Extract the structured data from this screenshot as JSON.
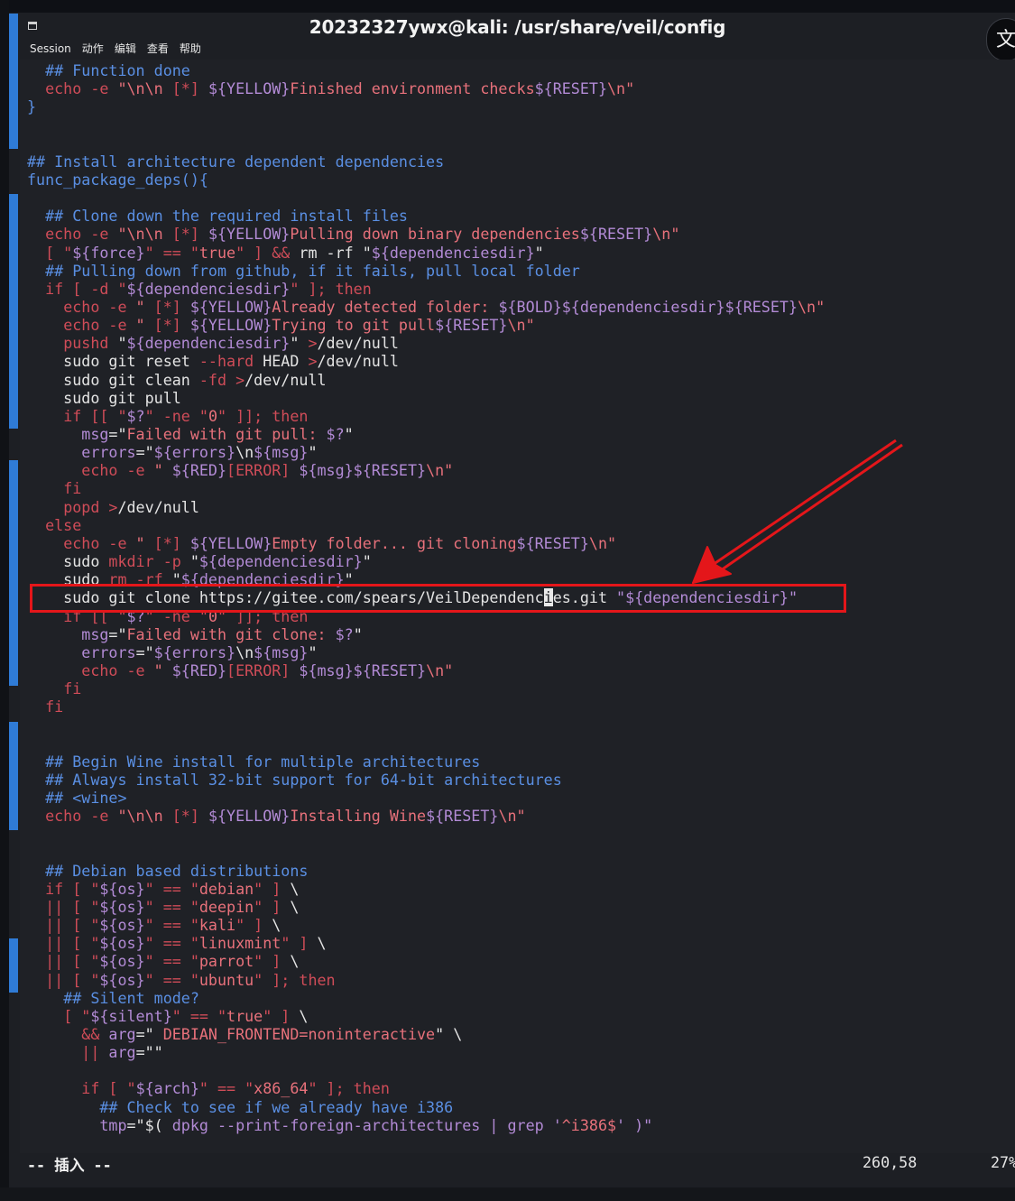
{
  "window": {
    "title": "20232327ywx@kali: /usr/share/veil/config",
    "translate_icon": "文"
  },
  "menubar": {
    "items": [
      "Session",
      "动作",
      "编辑",
      "查看",
      "帮助"
    ]
  },
  "colors": {
    "comment": "#5a8fe3",
    "keyword": "#cf4c58",
    "string": "#e8717b",
    "variable": "#b38bd6",
    "plain": "#e4e4e4",
    "annotation_red": "#e4161a"
  },
  "editor": {
    "lines": [
      [
        [
          "  ",
          "p"
        ],
        [
          "## Function done",
          "c"
        ]
      ],
      [
        [
          "  ",
          "p"
        ],
        [
          "echo",
          "k"
        ],
        [
          " ",
          "p"
        ],
        [
          "-e",
          "k"
        ],
        [
          " \"\\n\\n ",
          "s"
        ],
        [
          "[*]",
          "k"
        ],
        [
          " ",
          "s"
        ],
        [
          "${YELLOW}",
          "v"
        ],
        [
          "Finished environment checks",
          "s"
        ],
        [
          "${RESET}",
          "v"
        ],
        [
          "\\n\"",
          "s"
        ]
      ],
      [
        [
          "}",
          "c"
        ]
      ],
      [
        [
          "",
          "p"
        ]
      ],
      [
        [
          "",
          "p"
        ]
      ],
      [
        [
          "## Install architecture dependent dependencies",
          "c"
        ]
      ],
      [
        [
          "func_package_deps(){",
          "c"
        ]
      ],
      [
        [
          "",
          "p"
        ]
      ],
      [
        [
          "  ",
          "p"
        ],
        [
          "## Clone down the required install files",
          "c"
        ]
      ],
      [
        [
          "  ",
          "p"
        ],
        [
          "echo",
          "k"
        ],
        [
          " ",
          "p"
        ],
        [
          "-e",
          "k"
        ],
        [
          " \"\\n\\n ",
          "s"
        ],
        [
          "[*]",
          "k"
        ],
        [
          " ",
          "s"
        ],
        [
          "${YELLOW}",
          "v"
        ],
        [
          "Pulling down binary dependencies",
          "s"
        ],
        [
          "${RESET}",
          "v"
        ],
        [
          "\\n\"",
          "s"
        ]
      ],
      [
        [
          "  ",
          "p"
        ],
        [
          "[ \"",
          "k"
        ],
        [
          "${force}",
          "v"
        ],
        [
          "\" == \"",
          "k"
        ],
        [
          "true",
          "s"
        ],
        [
          "\" ] && ",
          "k"
        ],
        [
          "rm -rf \"",
          "p"
        ],
        [
          "${dependenciesdir}",
          "v"
        ],
        [
          "\"",
          "p"
        ]
      ],
      [
        [
          "  ",
          "p"
        ],
        [
          "## Pulling down from github, if it fails, pull local folder",
          "c"
        ]
      ],
      [
        [
          "  ",
          "p"
        ],
        [
          "if [ -d \"",
          "k"
        ],
        [
          "${dependenciesdir}",
          "v"
        ],
        [
          "\" ]; then",
          "k"
        ]
      ],
      [
        [
          "    ",
          "p"
        ],
        [
          "echo",
          "k"
        ],
        [
          " ",
          "p"
        ],
        [
          "-e",
          "k"
        ],
        [
          " \" ",
          "s"
        ],
        [
          "[*]",
          "k"
        ],
        [
          " ",
          "s"
        ],
        [
          "${YELLOW}",
          "v"
        ],
        [
          "Already detected folder: ",
          "s"
        ],
        [
          "${BOLD}${dependenciesdir}${RESET}",
          "v"
        ],
        [
          "\\n\"",
          "s"
        ]
      ],
      [
        [
          "    ",
          "p"
        ],
        [
          "echo",
          "k"
        ],
        [
          " ",
          "p"
        ],
        [
          "-e",
          "k"
        ],
        [
          " \" ",
          "s"
        ],
        [
          "[*]",
          "k"
        ],
        [
          " ",
          "s"
        ],
        [
          "${YELLOW}",
          "v"
        ],
        [
          "Trying to git pull",
          "s"
        ],
        [
          "${RESET}",
          "v"
        ],
        [
          "\\n\"",
          "s"
        ]
      ],
      [
        [
          "    ",
          "p"
        ],
        [
          "pushd",
          "k"
        ],
        [
          " \"",
          "p"
        ],
        [
          "${dependenciesdir}",
          "v"
        ],
        [
          "\" ",
          "p"
        ],
        [
          ">",
          "k"
        ],
        [
          "/dev/null",
          "p"
        ]
      ],
      [
        [
          "    sudo git reset ",
          "p"
        ],
        [
          "--",
          "k"
        ],
        [
          "hard",
          "k"
        ],
        [
          " HEAD ",
          "p"
        ],
        [
          ">",
          "k"
        ],
        [
          "/dev/null",
          "p"
        ]
      ],
      [
        [
          "    sudo git clean ",
          "p"
        ],
        [
          "-fd",
          "k"
        ],
        [
          " ",
          "p"
        ],
        [
          ">",
          "k"
        ],
        [
          "/dev/null",
          "p"
        ]
      ],
      [
        [
          "    sudo git pull",
          "p"
        ]
      ],
      [
        [
          "    ",
          "p"
        ],
        [
          "if [[ \"",
          "k"
        ],
        [
          "$?",
          "v"
        ],
        [
          "\" -ne \"",
          "k"
        ],
        [
          "0",
          "s"
        ],
        [
          "\" ]]; then",
          "k"
        ]
      ],
      [
        [
          "      ",
          "p"
        ],
        [
          "msg",
          "v"
        ],
        [
          "=\"",
          "p"
        ],
        [
          "Failed with git pull: ",
          "s"
        ],
        [
          "$?",
          "v"
        ],
        [
          "\"",
          "p"
        ]
      ],
      [
        [
          "      ",
          "p"
        ],
        [
          "errors",
          "v"
        ],
        [
          "=\"",
          "p"
        ],
        [
          "${errors}",
          "v"
        ],
        [
          "\\n",
          "p"
        ],
        [
          "${msg}",
          "v"
        ],
        [
          "\"",
          "p"
        ]
      ],
      [
        [
          "      ",
          "p"
        ],
        [
          "echo",
          "k"
        ],
        [
          " ",
          "p"
        ],
        [
          "-e",
          "k"
        ],
        [
          " \" ",
          "s"
        ],
        [
          "${RED}",
          "v"
        ],
        [
          "[ERROR]",
          "k"
        ],
        [
          " ",
          "s"
        ],
        [
          "${msg}${RESET}",
          "v"
        ],
        [
          "\\n\"",
          "s"
        ]
      ],
      [
        [
          "    ",
          "p"
        ],
        [
          "fi",
          "k"
        ]
      ],
      [
        [
          "    ",
          "p"
        ],
        [
          "popd",
          "k"
        ],
        [
          " ",
          "p"
        ],
        [
          ">",
          "k"
        ],
        [
          "/dev/null",
          "p"
        ]
      ],
      [
        [
          "  ",
          "p"
        ],
        [
          "else",
          "k"
        ]
      ],
      [
        [
          "    ",
          "p"
        ],
        [
          "echo",
          "k"
        ],
        [
          " ",
          "p"
        ],
        [
          "-e",
          "k"
        ],
        [
          " \" ",
          "s"
        ],
        [
          "[*]",
          "k"
        ],
        [
          " ",
          "s"
        ],
        [
          "${YELLOW}",
          "v"
        ],
        [
          "Empty folder... git cloning",
          "s"
        ],
        [
          "${RESET}",
          "v"
        ],
        [
          "\\n\"",
          "s"
        ]
      ],
      [
        [
          "    sudo ",
          "p"
        ],
        [
          "mkdir",
          "k"
        ],
        [
          " ",
          "p"
        ],
        [
          "-p",
          "k"
        ],
        [
          " \"",
          "p"
        ],
        [
          "${dependenciesdir}",
          "v"
        ],
        [
          "\"",
          "p"
        ]
      ],
      [
        [
          "    sudo ",
          "p"
        ],
        [
          "rm -rf",
          "k"
        ],
        [
          " \"",
          "p"
        ],
        [
          "${dependenciesdir}",
          "v"
        ],
        [
          "\"",
          "p"
        ]
      ],
      [
        [
          "    sudo git clone https://gitee.com/spears/VeilDependenc",
          "p"
        ],
        [
          "i",
          "cur"
        ],
        [
          "es.git ",
          "p"
        ],
        [
          "\"",
          "v"
        ],
        [
          "${dependenciesdir}",
          "v"
        ],
        [
          "\"",
          "v"
        ]
      ],
      [
        [
          "    ",
          "p"
        ],
        [
          "if [[ \"",
          "k"
        ],
        [
          "$?",
          "v"
        ],
        [
          "\" -ne \"",
          "k"
        ],
        [
          "0",
          "s"
        ],
        [
          "\" ]]; then",
          "k"
        ]
      ],
      [
        [
          "      ",
          "p"
        ],
        [
          "msg",
          "v"
        ],
        [
          "=\"",
          "p"
        ],
        [
          "Failed with git clone: ",
          "s"
        ],
        [
          "$?",
          "v"
        ],
        [
          "\"",
          "p"
        ]
      ],
      [
        [
          "      ",
          "p"
        ],
        [
          "errors",
          "v"
        ],
        [
          "=\"",
          "p"
        ],
        [
          "${errors}",
          "v"
        ],
        [
          "\\n",
          "p"
        ],
        [
          "${msg}",
          "v"
        ],
        [
          "\"",
          "p"
        ]
      ],
      [
        [
          "      ",
          "p"
        ],
        [
          "echo",
          "k"
        ],
        [
          " ",
          "p"
        ],
        [
          "-e",
          "k"
        ],
        [
          " \" ",
          "s"
        ],
        [
          "${RED}",
          "v"
        ],
        [
          "[ERROR]",
          "k"
        ],
        [
          " ",
          "s"
        ],
        [
          "${msg}${RESET}",
          "v"
        ],
        [
          "\\n\"",
          "s"
        ]
      ],
      [
        [
          "    ",
          "p"
        ],
        [
          "fi",
          "k"
        ]
      ],
      [
        [
          "  ",
          "p"
        ],
        [
          "fi",
          "k"
        ]
      ],
      [
        [
          "",
          "p"
        ]
      ],
      [
        [
          "",
          "p"
        ]
      ],
      [
        [
          "  ",
          "p"
        ],
        [
          "## Begin Wine install for multiple architectures",
          "c"
        ]
      ],
      [
        [
          "  ",
          "p"
        ],
        [
          "## Always install 32-bit support for 64-bit architectures",
          "c"
        ]
      ],
      [
        [
          "  ",
          "p"
        ],
        [
          "## <wine>",
          "c"
        ]
      ],
      [
        [
          "  ",
          "p"
        ],
        [
          "echo",
          "k"
        ],
        [
          " ",
          "p"
        ],
        [
          "-e",
          "k"
        ],
        [
          " \"\\n\\n ",
          "s"
        ],
        [
          "[*]",
          "k"
        ],
        [
          " ",
          "s"
        ],
        [
          "${YELLOW}",
          "v"
        ],
        [
          "Installing Wine",
          "s"
        ],
        [
          "${RESET}",
          "v"
        ],
        [
          "\\n\"",
          "s"
        ]
      ],
      [
        [
          "",
          "p"
        ]
      ],
      [
        [
          "",
          "p"
        ]
      ],
      [
        [
          "  ",
          "p"
        ],
        [
          "## Debian based distributions",
          "c"
        ]
      ],
      [
        [
          "  ",
          "p"
        ],
        [
          "if [ \"",
          "k"
        ],
        [
          "${os}",
          "v"
        ],
        [
          "\" == \"",
          "k"
        ],
        [
          "debian",
          "s"
        ],
        [
          "\" ]",
          "k"
        ],
        [
          " \\",
          "p"
        ]
      ],
      [
        [
          "  ",
          "p"
        ],
        [
          "|| [ \"",
          "k"
        ],
        [
          "${os}",
          "v"
        ],
        [
          "\" == \"",
          "k"
        ],
        [
          "deepin",
          "s"
        ],
        [
          "\" ]",
          "k"
        ],
        [
          " \\",
          "p"
        ]
      ],
      [
        [
          "  ",
          "p"
        ],
        [
          "|| [ \"",
          "k"
        ],
        [
          "${os}",
          "v"
        ],
        [
          "\" == \"",
          "k"
        ],
        [
          "kali",
          "s"
        ],
        [
          "\" ]",
          "k"
        ],
        [
          " \\",
          "p"
        ]
      ],
      [
        [
          "  ",
          "p"
        ],
        [
          "|| [ \"",
          "k"
        ],
        [
          "${os}",
          "v"
        ],
        [
          "\" == \"",
          "k"
        ],
        [
          "linuxmint",
          "s"
        ],
        [
          "\" ]",
          "k"
        ],
        [
          " \\",
          "p"
        ]
      ],
      [
        [
          "  ",
          "p"
        ],
        [
          "|| [ \"",
          "k"
        ],
        [
          "${os}",
          "v"
        ],
        [
          "\" == \"",
          "k"
        ],
        [
          "parrot",
          "s"
        ],
        [
          "\" ]",
          "k"
        ],
        [
          " \\",
          "p"
        ]
      ],
      [
        [
          "  ",
          "p"
        ],
        [
          "|| [ \"",
          "k"
        ],
        [
          "${os}",
          "v"
        ],
        [
          "\" == \"",
          "k"
        ],
        [
          "ubuntu",
          "s"
        ],
        [
          "\" ]; then",
          "k"
        ]
      ],
      [
        [
          "    ",
          "p"
        ],
        [
          "## Silent mode?",
          "c"
        ]
      ],
      [
        [
          "    ",
          "p"
        ],
        [
          "[ \"",
          "k"
        ],
        [
          "${silent}",
          "v"
        ],
        [
          "\" == \"",
          "k"
        ],
        [
          "true",
          "s"
        ],
        [
          "\" ]",
          "k"
        ],
        [
          " \\",
          "p"
        ]
      ],
      [
        [
          "      ",
          "p"
        ],
        [
          "&&",
          "k"
        ],
        [
          " ",
          "p"
        ],
        [
          "arg",
          "v"
        ],
        [
          "=\"",
          "p"
        ],
        [
          " DEBIAN_FRONTEND=noninteractive",
          "s"
        ],
        [
          "\" \\",
          "p"
        ]
      ],
      [
        [
          "      ",
          "p"
        ],
        [
          "||",
          "k"
        ],
        [
          " ",
          "p"
        ],
        [
          "arg",
          "v"
        ],
        [
          "=\"\"",
          "p"
        ]
      ],
      [
        [
          "",
          "p"
        ]
      ],
      [
        [
          "      ",
          "p"
        ],
        [
          "if [ \"",
          "k"
        ],
        [
          "${arch}",
          "v"
        ],
        [
          "\" == \"",
          "k"
        ],
        [
          "x86_64",
          "s"
        ],
        [
          "\" ]; then",
          "k"
        ]
      ],
      [
        [
          "        ",
          "p"
        ],
        [
          "## Check to see if we already have i386",
          "c"
        ]
      ],
      [
        [
          "        ",
          "p"
        ],
        [
          "tmp",
          "v"
        ],
        [
          "=\"$( ",
          "p"
        ],
        [
          "dpkg",
          "v"
        ],
        [
          " --print-foreign-architectures | grep '",
          "v"
        ],
        [
          "^i386$",
          "s"
        ],
        [
          "' )\"",
          "v"
        ]
      ]
    ]
  },
  "statusbar": {
    "mode": "-- 插入 --",
    "position": "260,58",
    "percent": "27%"
  }
}
